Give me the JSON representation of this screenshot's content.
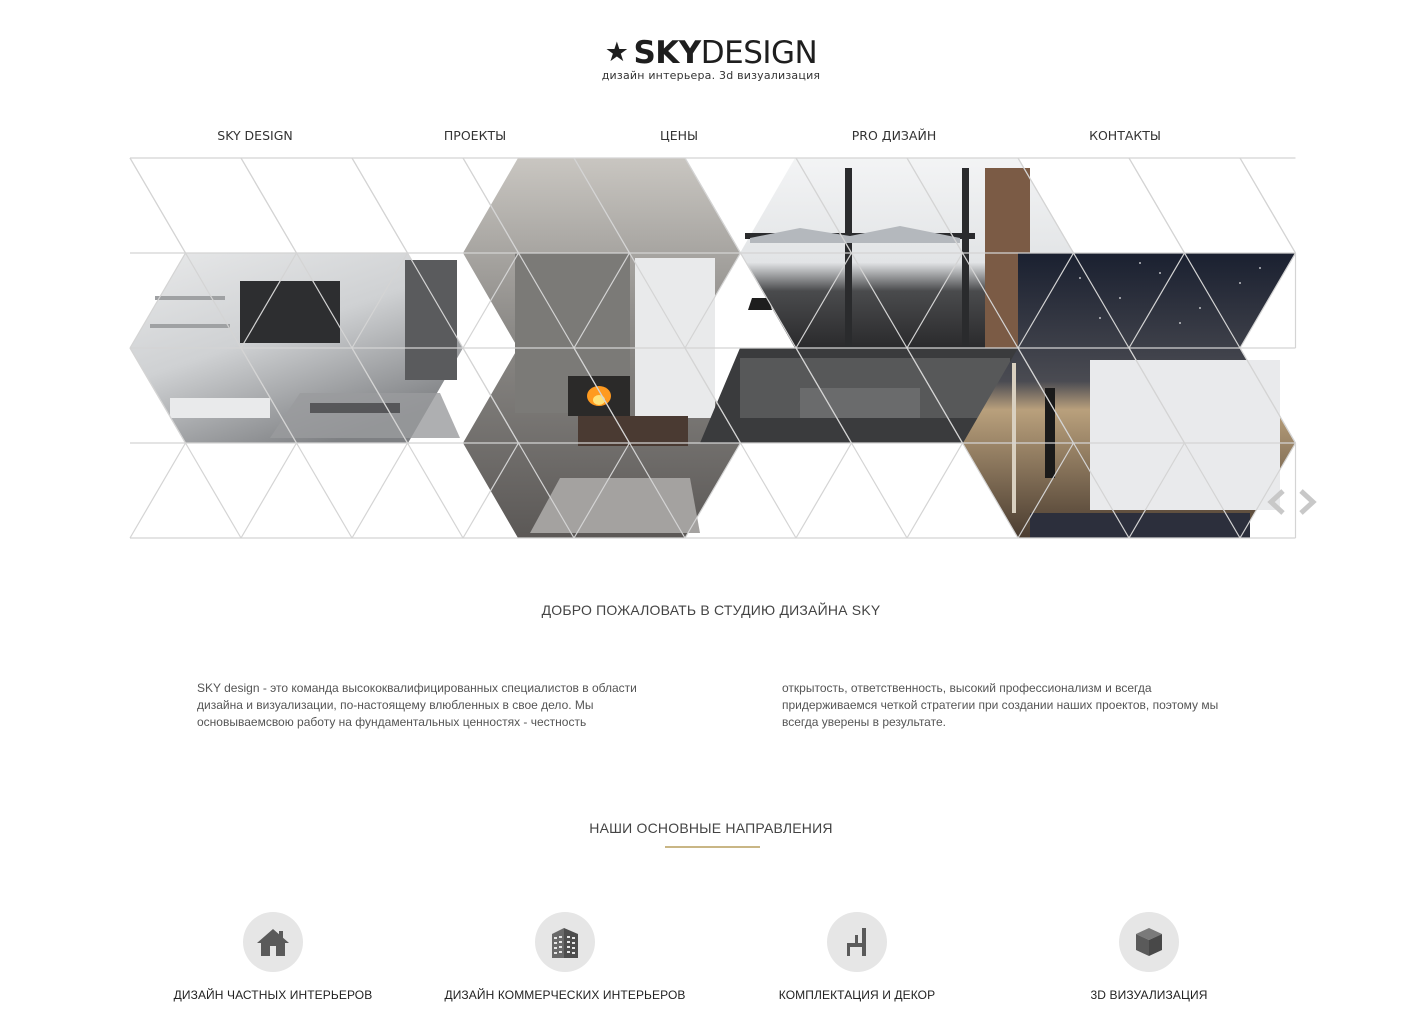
{
  "header": {
    "logo_star": "★",
    "logo_bold": "SKY",
    "logo_light": "DESIGN",
    "tagline": "дизайн интерьера. 3d визуализация"
  },
  "nav": {
    "items": [
      "SKY DESIGN",
      "ПРОЕКТЫ",
      "ЦЕНЫ",
      "PRO ДИЗАЙН",
      "КОНТАКТЫ"
    ]
  },
  "slider": {
    "images": [
      "living-room-tv-wall",
      "living-room-fireplace",
      "living-room-mountain-view",
      "home-cinema"
    ],
    "prev_icon": "chevron-left-icon",
    "next_icon": "chevron-right-icon"
  },
  "welcome": {
    "title": "ДОБРО ПОЖАЛОВАТЬ В СТУДИЮ ДИЗАЙНА SKY",
    "col1": "SKY design - это команда высококвалифицированных специалистов в области дизайна и визуализации, по-настоящему влюбленных в свое дело. Мы основываемсвою работу на фундаментальных ценностях - честность",
    "col2": "открытость, ответственность, высокий профессионализм и всегда придерживаемся четкой стратегии при создании наших проектов, поэтому мы всегда уверены в результате."
  },
  "directions": {
    "title": "НАШИ ОСНОВНЫЕ НАПРАВЛЕНИЯ",
    "accent_color": "#c9b685",
    "items": [
      {
        "label": "ДИЗАЙН ЧАСТНЫХ ИНТЕРЬЕРОВ",
        "icon": "house-icon"
      },
      {
        "label": "ДИЗАЙН КОММЕРЧЕСКИХ ИНТЕРЬЕРОВ",
        "icon": "building-icon"
      },
      {
        "label": "КОМПЛЕКТАЦИЯ И ДЕКОР",
        "icon": "chair-icon"
      },
      {
        "label": "3D ВИЗУАЛИЗАЦИЯ",
        "icon": "cube-icon"
      }
    ]
  }
}
